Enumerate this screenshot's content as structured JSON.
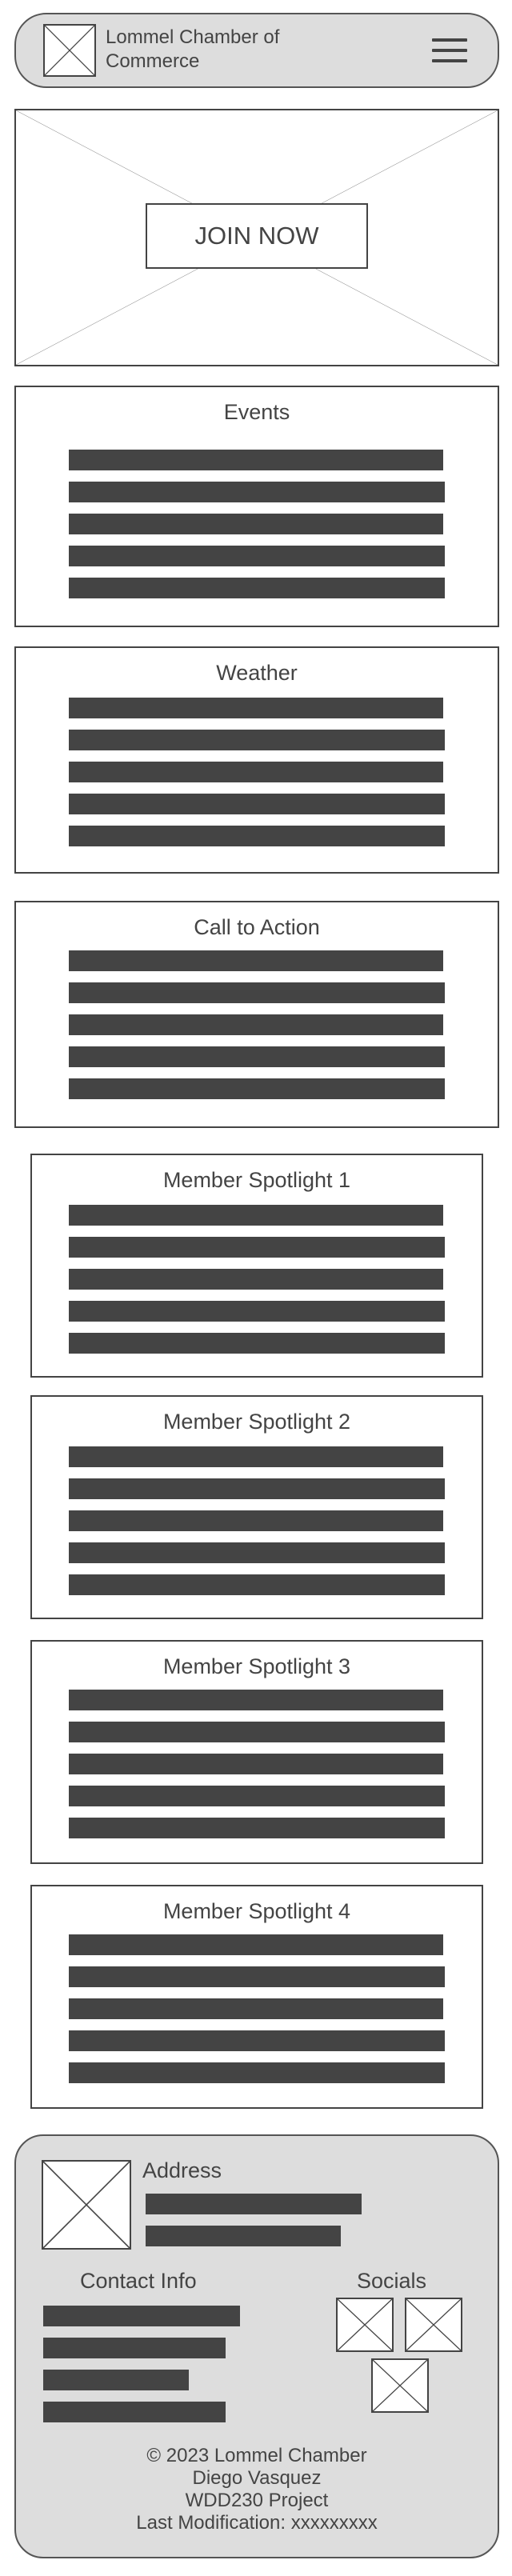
{
  "header": {
    "title_line1": "Lommel Chamber of",
    "title_line2": "Commerce",
    "logo_icon": "image-placeholder-icon",
    "menu_icon": "hamburger-menu-icon"
  },
  "hero": {
    "image_icon": "image-placeholder-icon",
    "cta_label": "JOIN NOW"
  },
  "sections": [
    {
      "title": "Events"
    },
    {
      "title": "Weather"
    },
    {
      "title": "Call to Action"
    },
    {
      "title": "Member Spotlight 1"
    },
    {
      "title": "Member Spotlight 2"
    },
    {
      "title": "Member Spotlight 3"
    },
    {
      "title": "Member Spotlight 4"
    }
  ],
  "footer": {
    "address_label": "Address",
    "contact_label": "Contact Info",
    "socials_label": "Socials",
    "social_icon": "image-placeholder-icon",
    "copyright": "© 2023 Lommel Chamber",
    "author": "Diego Vasquez",
    "project": "WDD230 Project",
    "last_modified": "Last Modification: xxxxxxxxx"
  },
  "colors": {
    "background": "#ffffff",
    "panel": "#dddddd",
    "ink": "#444444"
  }
}
